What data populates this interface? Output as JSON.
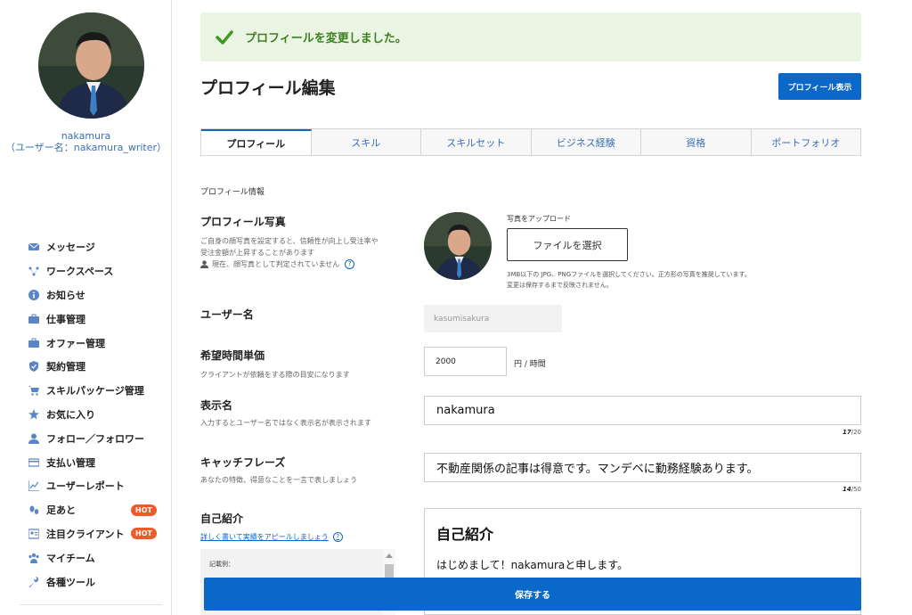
{
  "user": {
    "display_name": "nakamura",
    "username_line": "（ユーザー名：nakamura_writer）"
  },
  "sidebar": {
    "items": [
      {
        "label": "メッセージ",
        "icon": "envelope-icon"
      },
      {
        "label": "ワークスペース",
        "icon": "network-icon"
      },
      {
        "label": "お知らせ",
        "icon": "info-icon"
      },
      {
        "label": "仕事管理",
        "icon": "briefcase-icon"
      },
      {
        "label": "オファー管理",
        "icon": "briefcase-icon"
      },
      {
        "label": "契約管理",
        "icon": "shield-icon"
      },
      {
        "label": "スキルパッケージ管理",
        "icon": "cart-icon"
      },
      {
        "label": "お気に入り",
        "icon": "star-icon"
      },
      {
        "label": "フォロー／フォロワー",
        "icon": "user-icon"
      },
      {
        "label": "支払い管理",
        "icon": "card-icon"
      },
      {
        "label": "ユーザーレポート",
        "icon": "chart-icon"
      },
      {
        "label": "足あと",
        "icon": "footprint-icon",
        "badge": "HOT"
      },
      {
        "label": "注目クライアント",
        "icon": "client-icon",
        "badge": "HOT"
      },
      {
        "label": "マイチーム",
        "icon": "team-icon"
      },
      {
        "label": "各種ツール",
        "icon": "wrench-icon"
      }
    ]
  },
  "flash": {
    "message": "プロフィールを変更しました。",
    "color": "#3e7f20"
  },
  "header": {
    "title": "プロフィール編集",
    "view_button": "プロフィール表示"
  },
  "tabs": [
    {
      "label": "プロフィール",
      "active": true
    },
    {
      "label": "スキル"
    },
    {
      "label": "スキルセット"
    },
    {
      "label": "ビジネス経験"
    },
    {
      "label": "資格"
    },
    {
      "label": "ポートフォリオ"
    }
  ],
  "form": {
    "section_title": "プロフィール情報",
    "photo": {
      "label": "プロフィール写真",
      "desc1": "ご自身の顔写真を設定すると、信頼性が向上し受注率や",
      "desc2": "受注金額が上昇することがあります",
      "status": "現在、顔写真として判定されていません",
      "upload_label": "写真をアップロード",
      "file_button": "ファイルを選択",
      "note1": "3MB以下の JPG、PNGファイルを選択してください。正方形の写真を推奨しています。",
      "note2": "変更は保存するまで反映されません。"
    },
    "username": {
      "label": "ユーザー名",
      "value": "kasumisakura"
    },
    "rate": {
      "label": "希望時間単価",
      "desc": "クライアントが依頼をする際の目安になります",
      "value": "2000",
      "unit": "円 / 時間"
    },
    "display_name": {
      "label": "表示名",
      "desc": "入力するとユーザー名ではなく表示名が表示されます",
      "value": "nakamura",
      "count": "17",
      "max": "/20"
    },
    "catchphrase": {
      "label": "キャッチフレーズ",
      "desc": "あなたの特徴、得意なことを一言で表しましょう",
      "value": "不動産関係の記事は得意です。マンデベに勤務経験あります。",
      "count": "14",
      "max": "/50"
    },
    "intro": {
      "label": "自己紹介",
      "link": "詳しく書いて実績をアピールしましょう",
      "example_label": "記載例：",
      "heading": "自己紹介",
      "body": "はじめまして！nakamuraと申します。"
    },
    "save_button": "保存する"
  },
  "colors": {
    "accent": "#0b67c8",
    "hot_badge": "#f05a28",
    "success_bg": "#eaf5e3"
  }
}
